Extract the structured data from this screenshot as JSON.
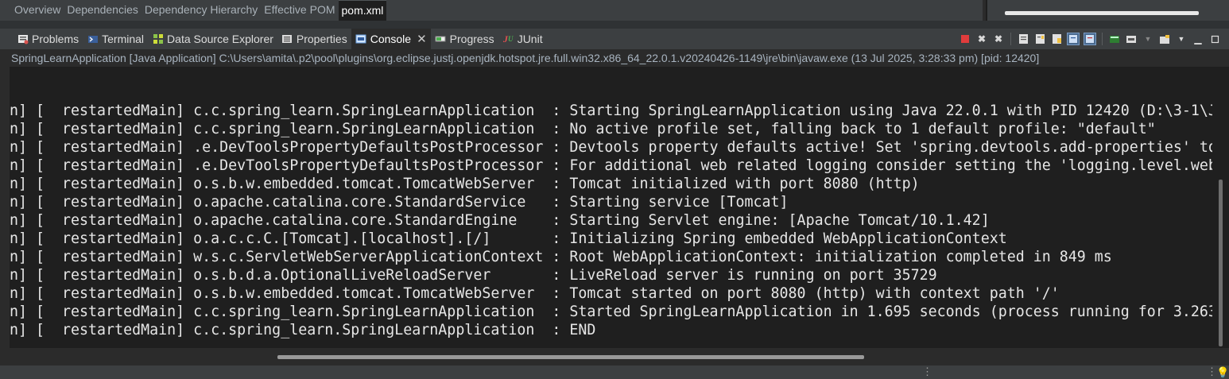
{
  "editor_tabs": [
    "Overview",
    "Dependencies",
    "Dependency Hierarchy",
    "Effective POM",
    "pom.xml"
  ],
  "active_editor_tab": "pom.xml",
  "view_tabs": {
    "problems": "Problems",
    "terminal": "Terminal",
    "data_source": "Data Source Explorer",
    "properties": "Properties",
    "console": "Console",
    "progress": "Progress",
    "junit": "JUnit"
  },
  "console_header": "SpringLearnApplication [Java Application] C:\\Users\\amita\\.p2\\pool\\plugins\\org.eclipse.justj.openjdk.hotspot.jre.full.win32.x86_64_22.0.1.v20240426-1149\\jre\\bin\\javaw.exe  (13 Jul 2025, 3:28:33 pm) [pid: 12420]",
  "console_lines": [
    "n] [  restartedMain] c.c.spring_learn.SpringLearnApplication  : Starting SpringLearnApplication using Java 22.0.1 with PID 12420 (D:\\3-1\\J",
    "n] [  restartedMain] c.c.spring_learn.SpringLearnApplication  : No active profile set, falling back to 1 default profile: \"default\"",
    "n] [  restartedMain] .e.DevToolsPropertyDefaultsPostProcessor : Devtools property defaults active! Set 'spring.devtools.add-properties' to",
    "n] [  restartedMain] .e.DevToolsPropertyDefaultsPostProcessor : For additional web related logging consider setting the 'logging.level.web",
    "n] [  restartedMain] o.s.b.w.embedded.tomcat.TomcatWebServer  : Tomcat initialized with port 8080 (http)",
    "n] [  restartedMain] o.apache.catalina.core.StandardService   : Starting service [Tomcat]",
    "n] [  restartedMain] o.apache.catalina.core.StandardEngine    : Starting Servlet engine: [Apache Tomcat/10.1.42]",
    "n] [  restartedMain] o.a.c.c.C.[Tomcat].[localhost].[/]       : Initializing Spring embedded WebApplicationContext",
    "n] [  restartedMain] w.s.c.ServletWebServerApplicationContext : Root WebApplicationContext: initialization completed in 849 ms",
    "n] [  restartedMain] o.s.b.d.a.OptionalLiveReloadServer       : LiveReload server is running on port 35729",
    "n] [  restartedMain] o.s.b.w.embedded.tomcat.TomcatWebServer  : Tomcat started on port 8080 (http) with context path '/'",
    "n] [  restartedMain] c.c.spring_learn.SpringLearnApplication  : Started SpringLearnApplication in 1.695 seconds (process running for 3.263",
    "n] [  restartedMain] c.c.spring_learn.SpringLearnApplication  : END"
  ],
  "colors": {
    "background": "#1f1f1f",
    "text": "#e6e6e6",
    "header_text": "#a8b4c0",
    "terminate_red": "#e03c3c"
  },
  "icons": [
    "problems-icon",
    "terminal-icon",
    "data-source-icon",
    "properties-icon",
    "console-icon",
    "progress-icon",
    "junit-icon",
    "terminate-icon",
    "remove-launch-icon",
    "remove-all-icon",
    "scroll-lock-icon",
    "word-wrap-icon",
    "pin-console-icon",
    "show-on-stdout-icon",
    "show-on-stderr-icon",
    "display-console-icon",
    "open-console-icon",
    "minimize-icon",
    "maximize-icon",
    "lightbulb-icon"
  ]
}
